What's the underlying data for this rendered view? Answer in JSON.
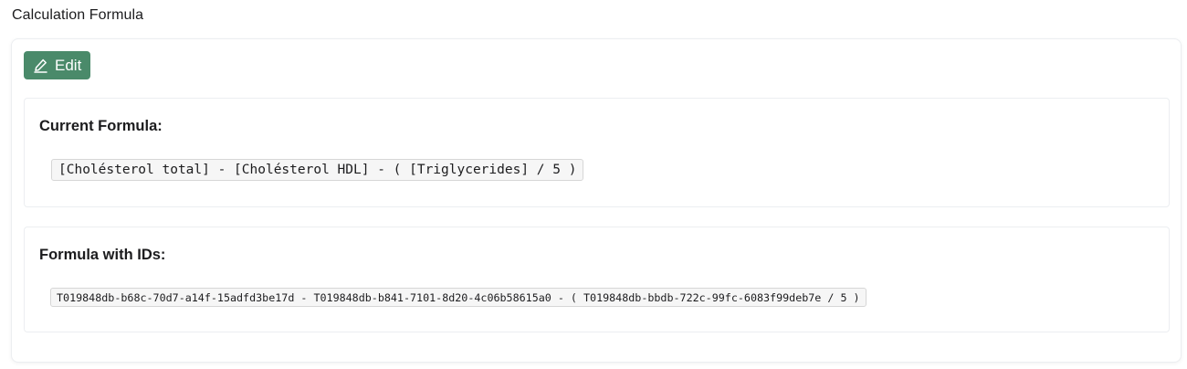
{
  "section": {
    "title": "Calculation Formula"
  },
  "toolbar": {
    "edit_label": "Edit",
    "edit_icon": "pencil-icon",
    "edit_color": "#4a8a6a"
  },
  "current_formula": {
    "title": "Current Formula:",
    "value": "[Cholésterol total] - [Cholésterol HDL] - ( [Triglycerides] / 5 )"
  },
  "formula_ids": {
    "title": "Formula with IDs:",
    "value": "T019848db-b68c-70d7-a14f-15adfd3be17d - T019848db-b841-7101-8d20-4c06b58615a0 - ( T019848db-bbdb-722c-99fc-6083f99deb7e / 5 )"
  }
}
